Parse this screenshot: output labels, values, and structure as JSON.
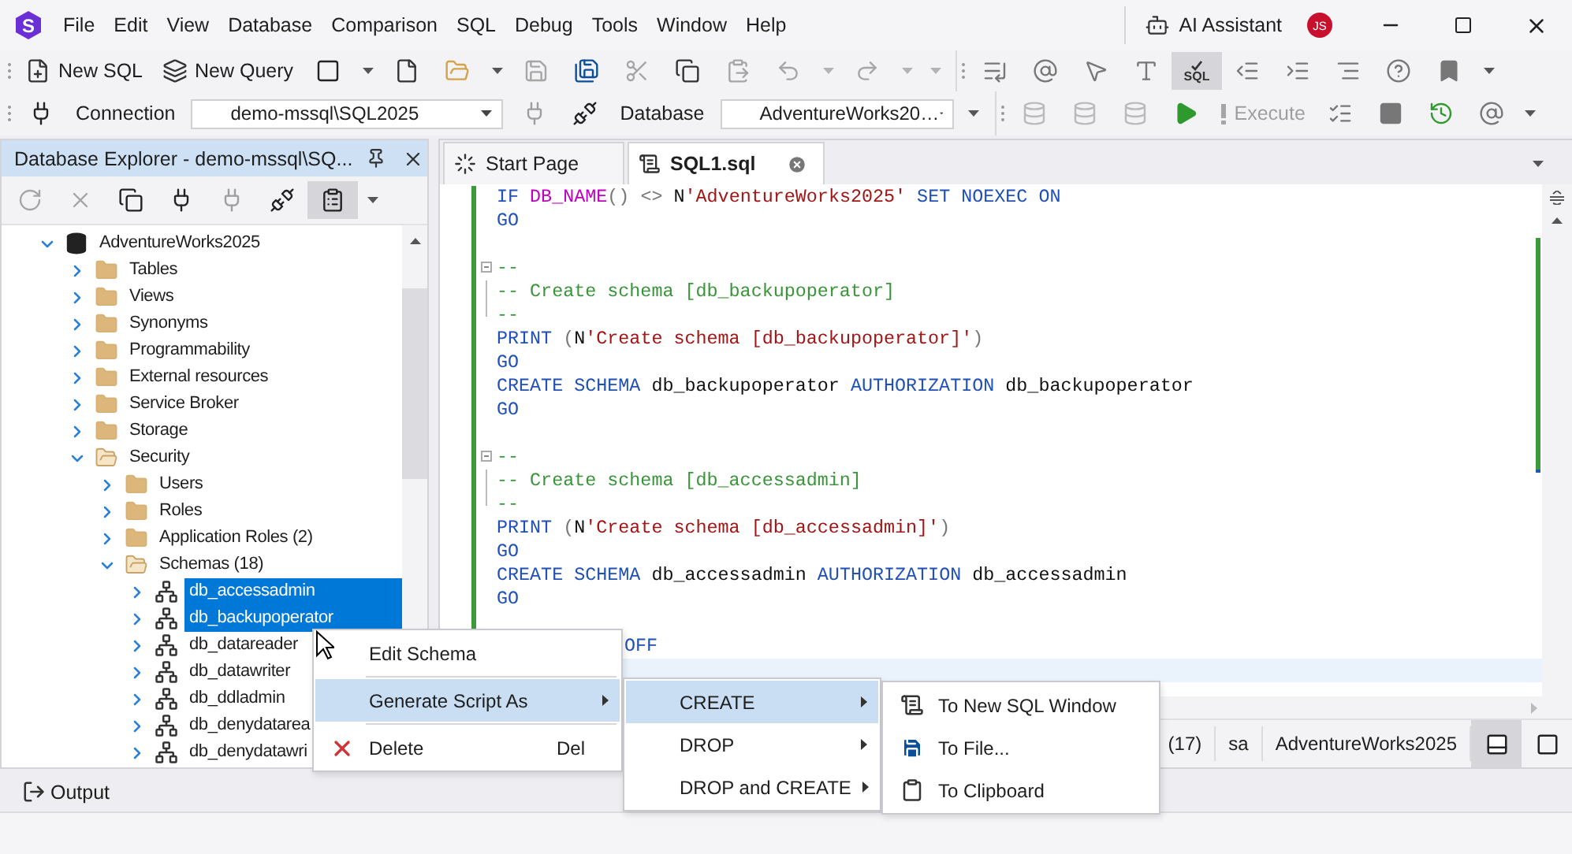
{
  "logo": {
    "letter": "S"
  },
  "menu": [
    "File",
    "Edit",
    "View",
    "Database",
    "Comparison",
    "SQL",
    "Debug",
    "Tools",
    "Window",
    "Help"
  ],
  "ai_assistant": {
    "label": "AI Assistant"
  },
  "user": {
    "initials": "JS"
  },
  "toolbar_1": [
    {
      "items": [
        {
          "kind": "newsql",
          "label": "New SQL",
          "disabled": false
        },
        {
          "kind": "newquery",
          "label": "New Query",
          "disabled": false
        },
        {
          "kind": "newblank",
          "disabled": false
        },
        {
          "kind": "caret",
          "disabled": false
        },
        {
          "kind": "newfile",
          "disabled": false
        },
        {
          "kind": "open",
          "disabled": false
        },
        {
          "kind": "caret",
          "disabled": false
        },
        {
          "kind": "save",
          "disabled": true
        },
        {
          "kind": "saveall",
          "disabled": false
        },
        {
          "kind": "cut",
          "disabled": true
        },
        {
          "kind": "copy",
          "disabled": false
        },
        {
          "kind": "paste",
          "disabled": true
        },
        {
          "kind": "undo",
          "disabled": true
        },
        {
          "kind": "caret",
          "disabled": true
        },
        {
          "kind": "redo",
          "disabled": true
        },
        {
          "kind": "caret",
          "disabled": true
        },
        {
          "kind": "caret",
          "disabled": true
        }
      ]
    },
    {
      "items": [
        {
          "kind": "listdown",
          "disabled": false
        },
        {
          "kind": "param",
          "disabled": false
        },
        {
          "kind": "select",
          "disabled": false
        },
        {
          "kind": "format",
          "disabled": false
        },
        {
          "kind": "sqltoggle",
          "label": "SQL",
          "on": true,
          "disabled": false
        },
        {
          "kind": "outdent",
          "disabled": false
        },
        {
          "kind": "indent",
          "disabled": false
        },
        {
          "kind": "align",
          "disabled": false
        },
        {
          "kind": "help",
          "disabled": false
        },
        {
          "kind": "bookmark",
          "disabled": false
        },
        {
          "kind": "caret",
          "disabled": false
        }
      ]
    }
  ],
  "toolbar_2": [
    {
      "items": [
        {
          "kind": "addconn",
          "disabled": false
        },
        {
          "kind": "label",
          "text": "Connection",
          "disabled": false
        },
        {
          "kind": "combo",
          "value": "demo-mssql\\SQL2025",
          "disabled": false
        },
        {
          "kind": "plug",
          "disabled": true
        },
        {
          "kind": "disconnect",
          "disabled": false
        },
        {
          "kind": "label",
          "text": "Database",
          "disabled": false
        },
        {
          "kind": "combo",
          "value": "AdventureWorks20…",
          "disabled": false
        },
        {
          "kind": "caret",
          "disabled": false
        }
      ]
    },
    {
      "items": [
        {
          "kind": "db",
          "disabled": true
        },
        {
          "kind": "db",
          "disabled": true
        },
        {
          "kind": "db",
          "disabled": true
        },
        {
          "kind": "run",
          "disabled": false
        },
        {
          "kind": "execute",
          "label": "Execute",
          "disabled": true
        },
        {
          "kind": "execlines",
          "disabled": false
        },
        {
          "kind": "stop",
          "disabled": false
        },
        {
          "kind": "history",
          "disabled": false
        },
        {
          "kind": "param",
          "disabled": false
        },
        {
          "kind": "caret",
          "disabled": false
        }
      ]
    }
  ],
  "explorer": {
    "title": "Database Explorer - demo-mssql\\SQ...",
    "tools": [
      {
        "kind": "refresh",
        "disabled": true
      },
      {
        "kind": "delete",
        "disabled": true
      },
      {
        "kind": "collapse",
        "disabled": false
      },
      {
        "kind": "addconn",
        "disabled": false
      },
      {
        "kind": "plug",
        "disabled": true
      },
      {
        "kind": "disconnect",
        "disabled": false
      },
      {
        "kind": "filter",
        "on": true,
        "disabled": false
      },
      {
        "kind": "caret",
        "disabled": false
      }
    ],
    "tree": [
      {
        "label": "AdventureWorks2025",
        "kind": "database",
        "expanded": true,
        "selected": false,
        "children": [
          {
            "label": "Tables",
            "kind": "folder",
            "expanded": false,
            "selected": false
          },
          {
            "label": "Views",
            "kind": "folder",
            "expanded": false,
            "selected": false
          },
          {
            "label": "Synonyms",
            "kind": "folder",
            "expanded": false,
            "selected": false
          },
          {
            "label": "Programmability",
            "kind": "folder",
            "expanded": false,
            "selected": false
          },
          {
            "label": "External resources",
            "kind": "folder",
            "expanded": false,
            "selected": false
          },
          {
            "label": "Service Broker",
            "kind": "folder",
            "expanded": false,
            "selected": false
          },
          {
            "label": "Storage",
            "kind": "folder",
            "expanded": false,
            "selected": false
          },
          {
            "label": "Security",
            "kind": "folder",
            "expanded": true,
            "selected": false,
            "children": [
              {
                "label": "Users",
                "kind": "folder",
                "expanded": false,
                "selected": false
              },
              {
                "label": "Roles",
                "kind": "folder",
                "expanded": false,
                "selected": false
              },
              {
                "label": "Application Roles (2)",
                "kind": "folder",
                "expanded": false,
                "selected": false
              },
              {
                "label": "Schemas (18)",
                "kind": "folder",
                "expanded": true,
                "selected": false,
                "children": [
                  {
                    "label": "db_accessadmin",
                    "kind": "schema",
                    "expanded": false,
                    "selected": true
                  },
                  {
                    "label": "db_backupoperator",
                    "kind": "schema",
                    "expanded": false,
                    "selected": true
                  },
                  {
                    "label": "db_datareader",
                    "kind": "schema",
                    "expanded": false,
                    "selected": false
                  },
                  {
                    "label": "db_datawriter",
                    "kind": "schema",
                    "expanded": false,
                    "selected": false
                  },
                  {
                    "label": "db_ddladmin",
                    "kind": "schema",
                    "expanded": false,
                    "selected": false
                  },
                  {
                    "label": "db_denydatarea",
                    "kind": "schema",
                    "expanded": false,
                    "selected": false
                  },
                  {
                    "label": "db_denydatawri",
                    "kind": "schema",
                    "expanded": false,
                    "selected": false
                  }
                ]
              }
            ]
          }
        ]
      }
    ]
  },
  "editor": {
    "tabs": [
      {
        "label": "Start Page",
        "kind": "start",
        "selected": false
      },
      {
        "label": "SQL1.sql",
        "kind": "sql",
        "selected": true
      }
    ],
    "lines": [
      {
        "kind": "code",
        "tokens": [
          {
            "kind": "kw",
            "t": "IF "
          },
          {
            "kind": "fn",
            "t": "DB_NAME"
          },
          {
            "kind": "op",
            "t": "() <> "
          },
          {
            "kind": "id",
            "t": "N"
          },
          {
            "kind": "str",
            "t": "'AdventureWorks2025'"
          },
          {
            "kind": "kw",
            "t": " SET NOEXEC ON"
          }
        ]
      },
      {
        "kind": "code",
        "tokens": [
          {
            "kind": "kw",
            "t": "GO"
          }
        ]
      },
      {
        "kind": "blank"
      },
      {
        "kind": "fold_start",
        "tokens": [
          {
            "kind": "cmt",
            "t": "--"
          }
        ]
      },
      {
        "kind": "fold_mid",
        "tokens": [
          {
            "kind": "cmt",
            "t": "-- Create schema [db_backupoperator]"
          }
        ]
      },
      {
        "kind": "fold_end",
        "tokens": [
          {
            "kind": "cmt",
            "t": "--"
          }
        ]
      },
      {
        "kind": "code",
        "tokens": [
          {
            "kind": "kw",
            "t": "PRINT "
          },
          {
            "kind": "op",
            "t": "("
          },
          {
            "kind": "id",
            "t": "N"
          },
          {
            "kind": "str",
            "t": "'Create schema [db_backupoperator]'"
          },
          {
            "kind": "op",
            "t": ")"
          }
        ]
      },
      {
        "kind": "code",
        "tokens": [
          {
            "kind": "kw",
            "t": "GO"
          }
        ]
      },
      {
        "kind": "code",
        "tokens": [
          {
            "kind": "kw",
            "t": "CREATE SCHEMA "
          },
          {
            "kind": "id",
            "t": "db_backupoperator "
          },
          {
            "kind": "kw",
            "t": "AUTHORIZATION "
          },
          {
            "kind": "id",
            "t": "db_backupoperator"
          }
        ]
      },
      {
        "kind": "code",
        "tokens": [
          {
            "kind": "kw",
            "t": "GO"
          }
        ]
      },
      {
        "kind": "blank"
      },
      {
        "kind": "fold_start",
        "tokens": [
          {
            "kind": "cmt",
            "t": "--"
          }
        ]
      },
      {
        "kind": "fold_mid",
        "tokens": [
          {
            "kind": "cmt",
            "t": "-- Create schema [db_accessadmin]"
          }
        ]
      },
      {
        "kind": "fold_end",
        "tokens": [
          {
            "kind": "cmt",
            "t": "--"
          }
        ]
      },
      {
        "kind": "code",
        "tokens": [
          {
            "kind": "kw",
            "t": "PRINT "
          },
          {
            "kind": "op",
            "t": "("
          },
          {
            "kind": "id",
            "t": "N"
          },
          {
            "kind": "str",
            "t": "'Create schema [db_accessadmin]'"
          },
          {
            "kind": "op",
            "t": ")"
          }
        ]
      },
      {
        "kind": "code",
        "tokens": [
          {
            "kind": "kw",
            "t": "GO"
          }
        ]
      },
      {
        "kind": "code",
        "tokens": [
          {
            "kind": "kw",
            "t": "CREATE SCHEMA "
          },
          {
            "kind": "id",
            "t": "db_accessadmin "
          },
          {
            "kind": "kw",
            "t": "AUTHORIZATION "
          },
          {
            "kind": "id",
            "t": "db_accessadmin"
          }
        ]
      },
      {
        "kind": "code",
        "tokens": [
          {
            "kind": "kw",
            "t": "GO"
          }
        ]
      },
      {
        "kind": "blank"
      },
      {
        "kind": "clipped",
        "tokens": [
          {
            "kind": "kw",
            "t": "OFF"
          }
        ]
      },
      {
        "kind": "current"
      }
    ],
    "status": [
      "(17)",
      "sa",
      "AdventureWorks2025"
    ],
    "layouts": [
      {
        "kind": "split",
        "selected": true
      },
      {
        "kind": "single",
        "selected": false
      }
    ]
  },
  "output": {
    "label": "Output"
  },
  "menus": [
    {
      "dividers": true,
      "items": [
        {
          "kind": "plain",
          "label": "Edit Schema",
          "selected": false
        },
        {
          "kind": "submenu",
          "label": "Generate Script As",
          "selected": true
        },
        {
          "kind": "remove",
          "label": "Delete",
          "shortcut": "Del",
          "selected": false
        }
      ]
    },
    {
      "dividers": false,
      "items": [
        {
          "kind": "submenu",
          "label": "CREATE",
          "selected": true
        },
        {
          "kind": "submenu",
          "label": "DROP",
          "selected": false
        },
        {
          "kind": "submenu",
          "label": "DROP and CREATE",
          "selected": false
        }
      ]
    },
    {
      "dividers": false,
      "items": [
        {
          "kind": "window",
          "label": "To New SQL Window",
          "selected": false
        },
        {
          "kind": "file",
          "label": "To File...",
          "selected": false
        },
        {
          "kind": "clipboard",
          "label": "To Clipboard",
          "selected": false
        }
      ]
    }
  ]
}
